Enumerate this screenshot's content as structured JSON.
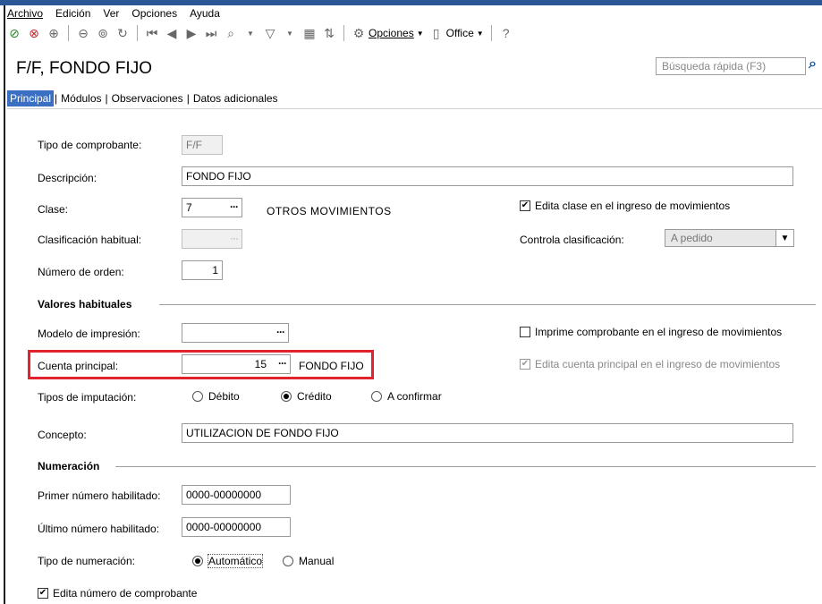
{
  "menu": {
    "archivo": "Archivo",
    "edicion": "Edición",
    "ver": "Ver",
    "opciones": "Opciones",
    "ayuda": "Ayuda"
  },
  "toolbar": {
    "opciones_label": "Opciones",
    "office_label": "Office"
  },
  "title": "F/F, FONDO FIJO",
  "search": {
    "placeholder": "Búsqueda rápida (F3)"
  },
  "tabs": [
    "Principal",
    "Módulos",
    "Observaciones",
    "Datos adicionales"
  ],
  "form": {
    "tipo_comprobante_label": "Tipo de comprobante:",
    "tipo_comprobante_value": "F/F",
    "descripcion_label": "Descripción:",
    "descripcion_value": "FONDO FIJO",
    "clase_label": "Clase:",
    "clase_value": "7",
    "clase_desc": "OTROS MOVIMIENTOS",
    "edita_clase_label": "Edita clase en el ingreso de movimientos",
    "clasificacion_label": "Clasificación habitual:",
    "controla_clasificacion_label": "Controla clasificación:",
    "controla_clasificacion_value": "A pedido",
    "numero_orden_label": "Número de orden:",
    "numero_orden_value": "1"
  },
  "valores": {
    "section_title": "Valores habituales",
    "modelo_label": "Modelo de impresión:",
    "imprime_label": "Imprime comprobante en el ingreso de movimientos",
    "cuenta_label": "Cuenta principal:",
    "cuenta_value": "15",
    "cuenta_desc": "FONDO FIJO",
    "edita_cuenta_label": "Edita cuenta principal en el ingreso de movimientos",
    "imputacion_label": "Tipos de imputación:",
    "debito": "Débito",
    "credito": "Crédito",
    "a_confirmar": "A confirmar",
    "concepto_label": "Concepto:",
    "concepto_value": "UTILIZACION DE FONDO FIJO"
  },
  "numeracion": {
    "section_title": "Numeración",
    "primer_label": "Primer número habilitado:",
    "primer_value": "0000-00000000",
    "ultimo_label": "Último número habilitado:",
    "ultimo_value": "0000-00000000",
    "tipo_label": "Tipo de numeración:",
    "automatico": "Automático",
    "manual": "Manual",
    "edita_numero_label": "Edita número de comprobante"
  },
  "colors": {
    "accent": "#3b6fc4",
    "highlight": "#e0232d",
    "topband": "#2b5797"
  }
}
